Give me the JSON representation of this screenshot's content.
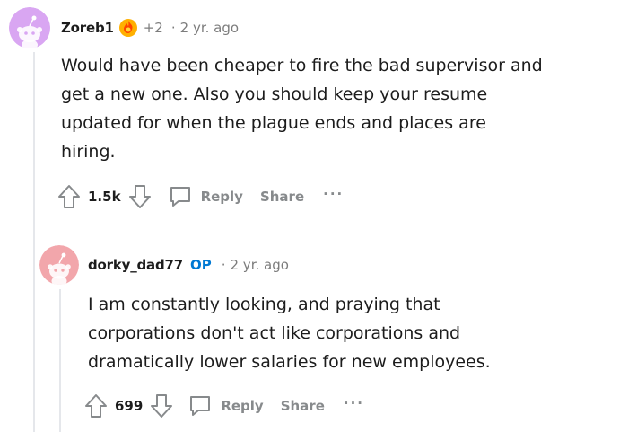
{
  "comments": [
    {
      "username": "Zoreb1",
      "flair_icon": "fire-award-icon",
      "karma": "+2",
      "separator": "·",
      "time": "2 yr. ago",
      "body_lines": [
        "Would have been cheaper to fire the bad supervisor and",
        "get a new one. Also you should keep your resume",
        "updated for when the plague ends and places are",
        "hiring."
      ],
      "score": "1.5k",
      "reply_label": "Reply",
      "share_label": "Share",
      "more_label": "···",
      "avatar_color": "#d9a6f2"
    },
    {
      "username": "dorky_dad77",
      "op_badge": "OP",
      "separator": "·",
      "time": "2 yr. ago",
      "body_lines": [
        "I am constantly looking, and praying that",
        "corporations don't act like corporations and",
        "dramatically lower salaries for new employees."
      ],
      "score": "699",
      "reply_label": "Reply",
      "share_label": "Share",
      "more_label": "···",
      "avatar_color": "#f2a6ab"
    }
  ],
  "colors": {
    "text": "#1c1c1c",
    "muted": "#7c7c7c",
    "action": "#878a8c",
    "op_blue": "#0079d3",
    "thread_line": "#e5e7eb"
  }
}
